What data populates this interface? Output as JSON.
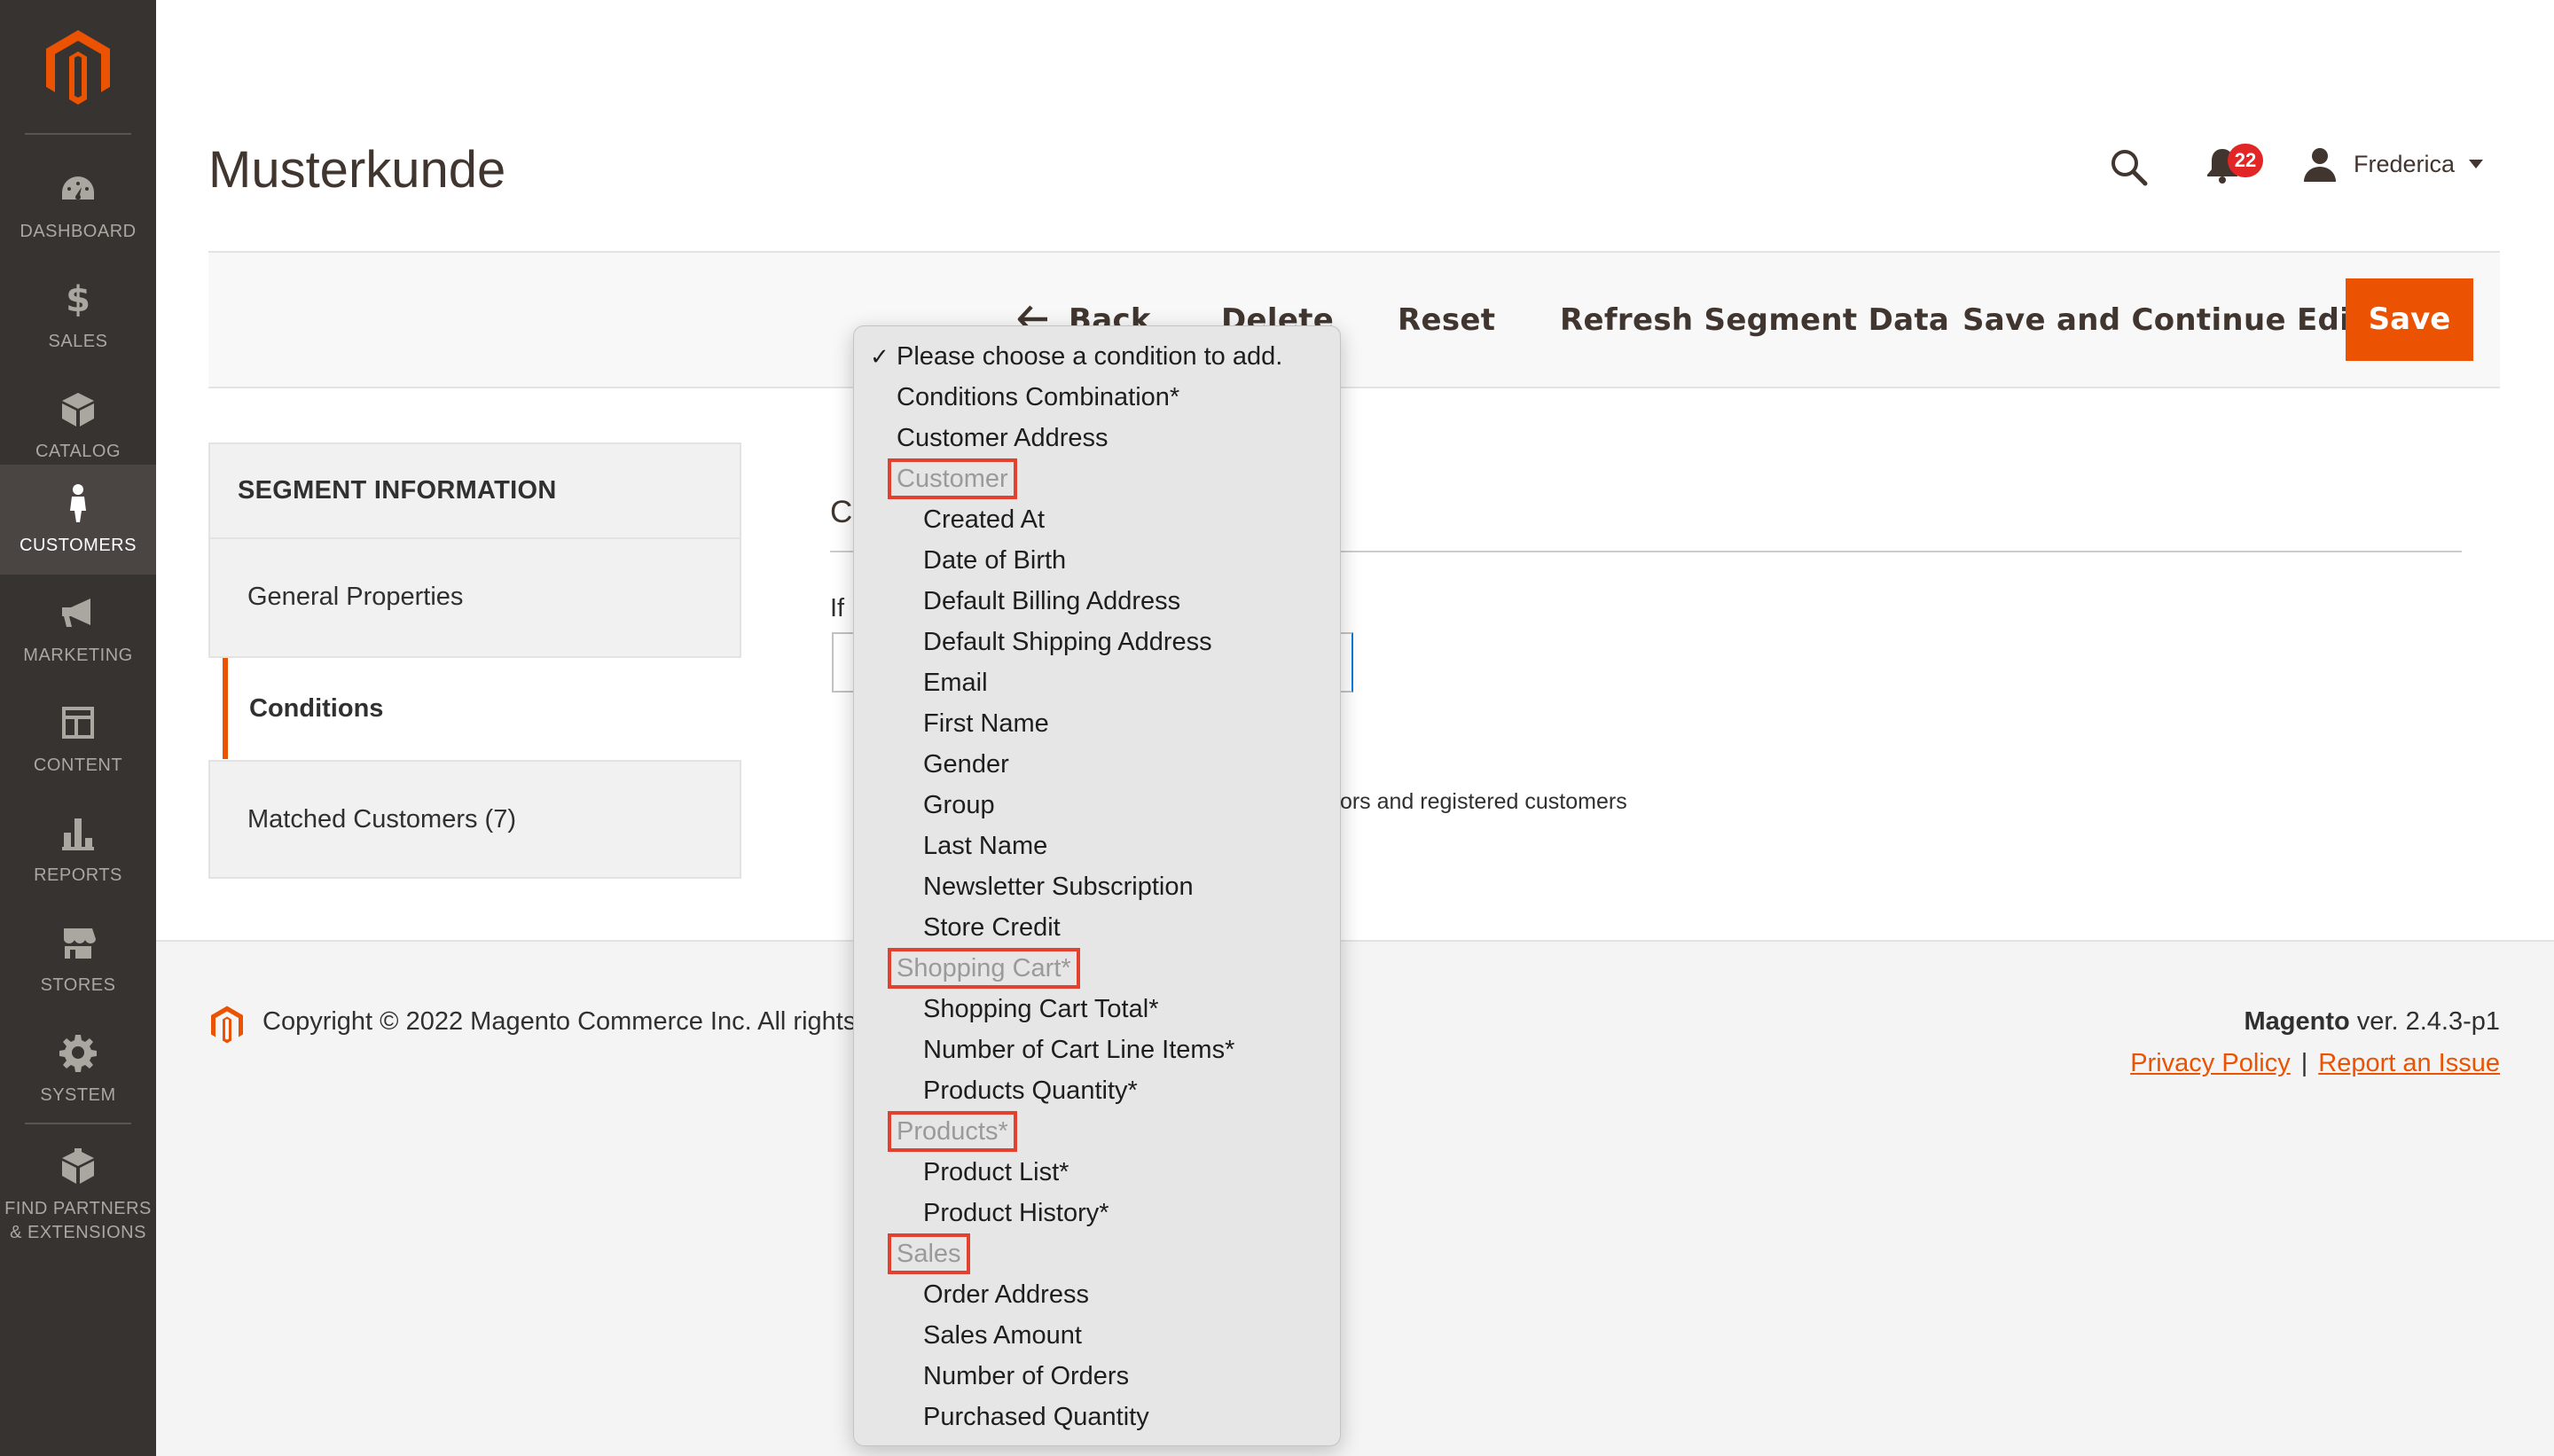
{
  "sidebar": {
    "items": [
      {
        "label": "DASHBOARD",
        "icon": "dashboard-icon"
      },
      {
        "label": "SALES",
        "icon": "dollar-icon"
      },
      {
        "label": "CATALOG",
        "icon": "box-icon"
      },
      {
        "label": "CUSTOMERS",
        "icon": "customer-icon",
        "active": true
      },
      {
        "label": "MARKETING",
        "icon": "megaphone-icon"
      },
      {
        "label": "CONTENT",
        "icon": "content-layout-icon"
      },
      {
        "label": "REPORTS",
        "icon": "bar-chart-icon"
      },
      {
        "label": "STORES",
        "icon": "store-icon"
      },
      {
        "label": "SYSTEM",
        "icon": "gear-icon"
      },
      {
        "label_line1": "FIND PARTNERS",
        "label_line2": "& EXTENSIONS",
        "icon": "extensions-box-icon"
      }
    ]
  },
  "header": {
    "title": "Musterkunde",
    "notifications_count": "22",
    "user_name": "Frederica"
  },
  "actions": {
    "back": "Back",
    "delete": "Delete",
    "reset": "Reset",
    "refresh": "Refresh Segment Data",
    "save_continue": "Save and Continue Edit",
    "save": "Save"
  },
  "tabs": {
    "title": "SEGMENT INFORMATION",
    "items": [
      "General Properties",
      "Conditions",
      "Matched Customers (7)"
    ],
    "active": "Conditions"
  },
  "content": {
    "section_title_fragment": "C",
    "if_fragment": "If ",
    "applies_fragment": "tors and registered customers"
  },
  "dropdown": {
    "selected": "Please choose a condition to add.",
    "options": [
      {
        "type": "option",
        "label": "Please choose a condition to add.",
        "checked": true
      },
      {
        "type": "option",
        "label": "Conditions Combination*"
      },
      {
        "type": "option",
        "label": "Customer Address"
      },
      {
        "type": "group",
        "label": "Customer"
      },
      {
        "type": "option",
        "label": "Created At",
        "indent": 1
      },
      {
        "type": "option",
        "label": "Date of Birth",
        "indent": 1
      },
      {
        "type": "option",
        "label": "Default Billing Address",
        "indent": 1
      },
      {
        "type": "option",
        "label": "Default Shipping Address",
        "indent": 1
      },
      {
        "type": "option",
        "label": "Email",
        "indent": 1
      },
      {
        "type": "option",
        "label": "First Name",
        "indent": 1
      },
      {
        "type": "option",
        "label": "Gender",
        "indent": 1
      },
      {
        "type": "option",
        "label": "Group",
        "indent": 1
      },
      {
        "type": "option",
        "label": "Last Name",
        "indent": 1
      },
      {
        "type": "option",
        "label": "Newsletter Subscription",
        "indent": 1
      },
      {
        "type": "option",
        "label": "Store Credit",
        "indent": 1
      },
      {
        "type": "group",
        "label": "Shopping Cart*"
      },
      {
        "type": "option",
        "label": "Shopping Cart Total*",
        "indent": 1
      },
      {
        "type": "option",
        "label": "Number of Cart Line Items*",
        "indent": 1
      },
      {
        "type": "option",
        "label": "Products Quantity*",
        "indent": 1
      },
      {
        "type": "group",
        "label": "Products*"
      },
      {
        "type": "option",
        "label": "Product List*",
        "indent": 1
      },
      {
        "type": "option",
        "label": "Product History*",
        "indent": 1
      },
      {
        "type": "group",
        "label": "Sales"
      },
      {
        "type": "option",
        "label": "Order Address",
        "indent": 1
      },
      {
        "type": "option",
        "label": "Sales Amount",
        "indent": 1
      },
      {
        "type": "option",
        "label": "Number of Orders",
        "indent": 1
      },
      {
        "type": "option",
        "label": "Purchased Quantity",
        "indent": 1
      }
    ]
  },
  "footer": {
    "copyright": "Copyright © 2022 Magento Commerce Inc. All rights",
    "version_brand": "Magento",
    "version_text": " ver. 2.4.3-p1",
    "privacy": "Privacy Policy",
    "separator": "|",
    "report_issue": "Report an Issue"
  },
  "colors": {
    "sidebar_bg": "#373330",
    "accent": "#eb5202",
    "highlight_box": "#e2412f",
    "badge": "#e22626"
  }
}
